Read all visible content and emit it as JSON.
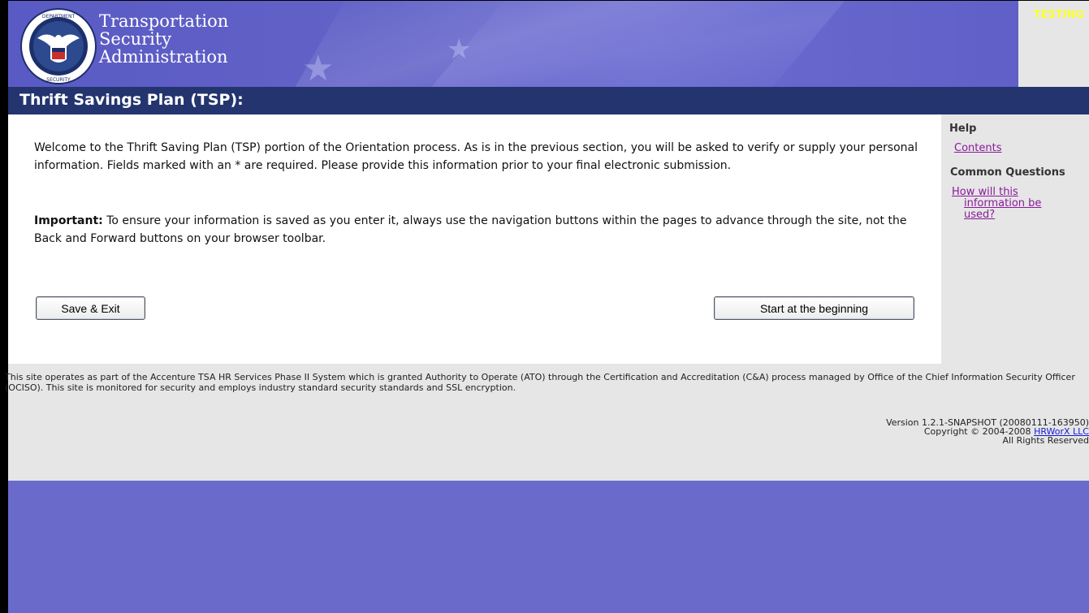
{
  "header": {
    "agency_line1": "Transportation",
    "agency_line2": "Security",
    "agency_line3": "Administration",
    "seal_text": "U.S. DEPARTMENT OF HOMELAND SECURITY",
    "environment_label": "TESTING"
  },
  "page": {
    "title": "Thrift Savings Plan (TSP):"
  },
  "main": {
    "welcome_text": "Welcome to the Thrift Saving Plan (TSP) portion of the Orientation process. As is in the previous section, you will be asked to verify or supply your personal information. Fields marked with an * are required. Please provide this information prior to your final electronic submission.",
    "important_label": "Important:",
    "important_text": " To ensure your information is saved as you enter it, always use the navigation buttons within the pages to advance through the site, not the Back and Forward buttons on your browser toolbar.",
    "save_exit_label": "Save & Exit",
    "start_label": "Start at the beginning"
  },
  "sidebar": {
    "help_heading": "Help",
    "contents_link": "Contents",
    "common_questions_heading": "Common Questions",
    "question_line1": "How will this",
    "question_line2": "information be",
    "question_line3": "used?"
  },
  "footer": {
    "disclaimer": "This site operates as part of the Accenture TSA HR Services Phase II System which is granted Authority to Operate (ATO) through the Certification and Accreditation (C&A) process managed by Office of the Chief Information Security Officer (OCISO). This site is monitored for security and employs industry standard security standards and SSL encryption.",
    "version": "Version 1.2.1-SNAPSHOT (20080111-163950)",
    "copyright_prefix": "Copyright © 2004-2008 ",
    "company_link": "HRWorX LLC",
    "rights": "All Rights Reserved"
  },
  "colors": {
    "header_bg": "#6262c8",
    "title_bar_bg": "#23346f",
    "sidebar_bg": "#e6e6e6",
    "link_visited": "#8a1a9b",
    "testing_label": "#ffff33"
  }
}
